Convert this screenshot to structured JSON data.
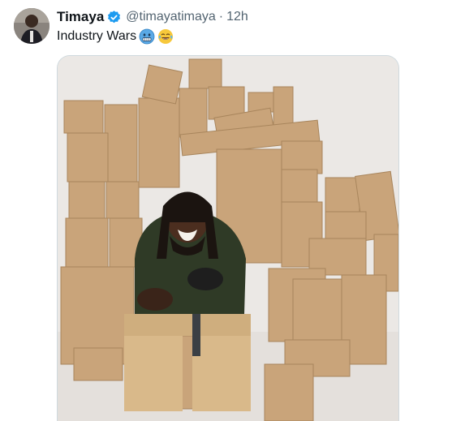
{
  "tweet": {
    "display_name": "Timaya",
    "handle": "@timayatimaya",
    "separator": "·",
    "timestamp": "12h",
    "text": "Industry Wars",
    "emojis": [
      "cold-face-emoji",
      "tears-of-joy-emoji"
    ],
    "verified_color": "#1d9bf0",
    "media_description_icon": "photo"
  },
  "colors": {
    "text": "#0f1419",
    "secondary": "#536471",
    "border": "#cfd9de",
    "box": "#c9a47a"
  }
}
